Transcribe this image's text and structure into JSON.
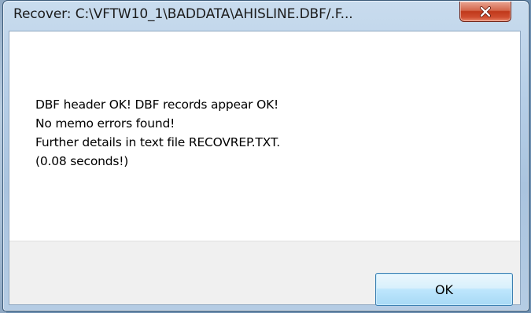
{
  "window": {
    "title": "Recover: C:\\VFTW10_1\\BADDATA\\AHISLINE.DBF/.F..."
  },
  "message": {
    "lines": [
      "DBF header OK! DBF records appear OK!",
      "No memo errors found!",
      "Further details in text file RECOVREP.TXT.",
      "(0.08 seconds!)"
    ]
  },
  "buttons": {
    "ok_label": "OK"
  },
  "icons": {
    "close": "close-icon"
  },
  "colors": {
    "close_button": "#c0391b",
    "ok_button_border": "#3c7fb1"
  }
}
